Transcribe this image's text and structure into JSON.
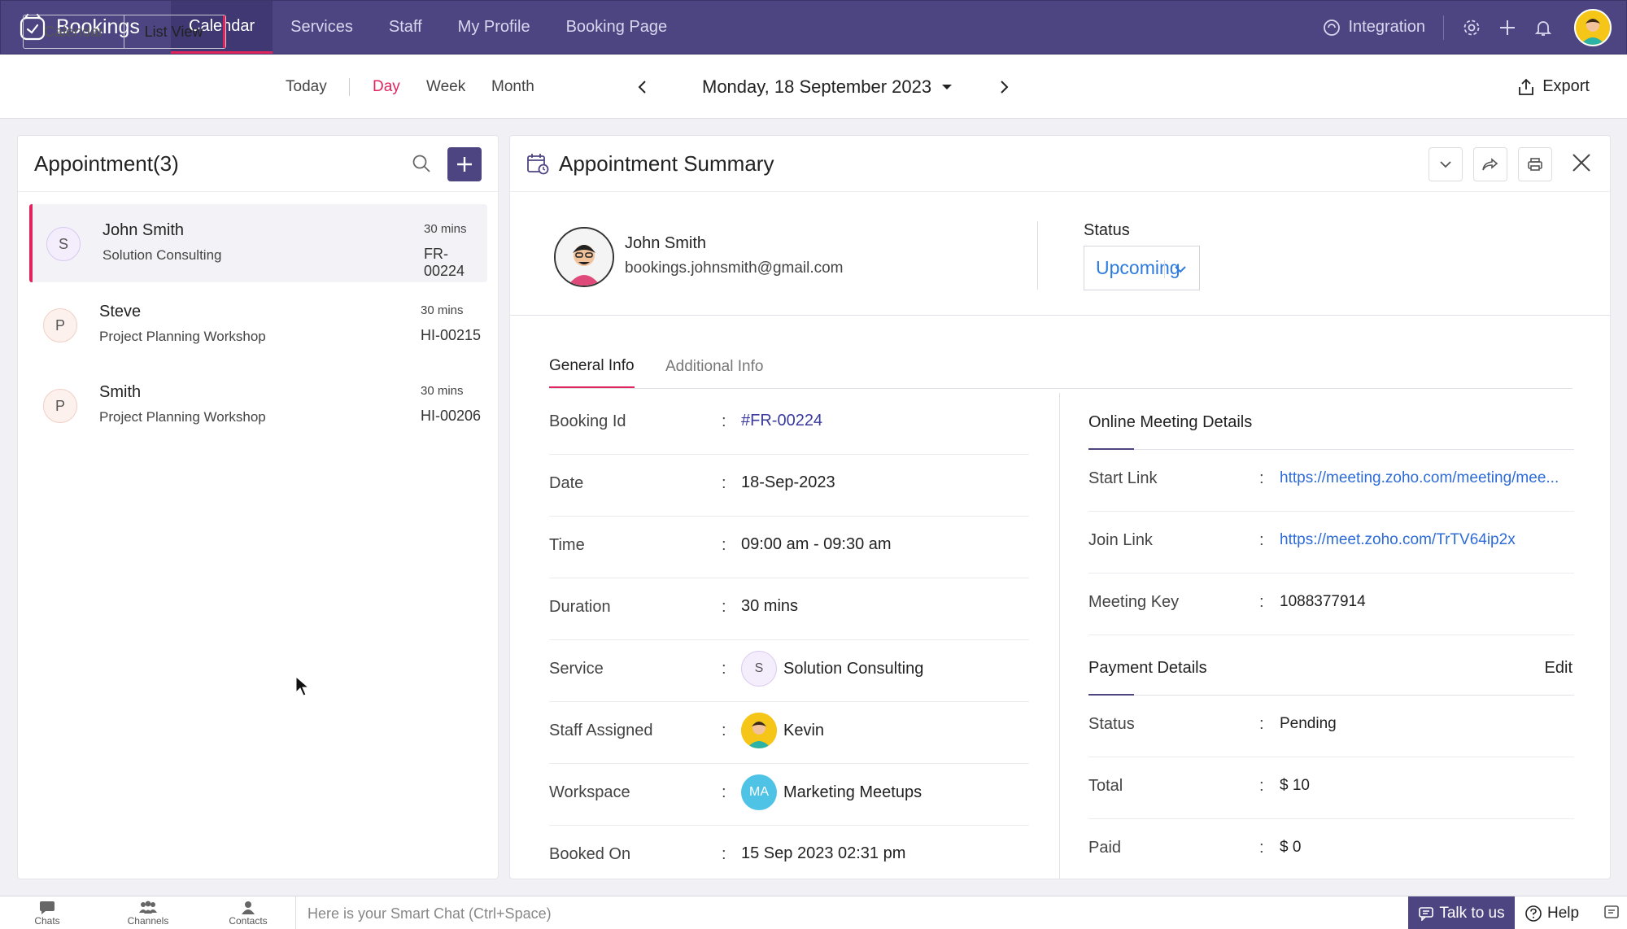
{
  "app": {
    "name": "Bookings",
    "nav": [
      "Calendar",
      "Services",
      "Staff",
      "My Profile",
      "Booking Page"
    ],
    "integration_label": "Integration"
  },
  "toolbar": {
    "view_toggle": [
      "Calendar",
      "List View"
    ],
    "today": "Today",
    "ranges": [
      "Day",
      "Week",
      "Month"
    ],
    "current_date": "Monday, 18 September 2023",
    "export": "Export"
  },
  "appointments": {
    "title": "Appointment(3)",
    "items": [
      {
        "initial": "S",
        "name": "John Smith",
        "service": "Solution Consulting",
        "duration": "30 mins",
        "id": "FR-00224"
      },
      {
        "initial": "P",
        "name": "Steve",
        "service": "Project Planning Workshop",
        "duration": "30 mins",
        "id": "HI-00215"
      },
      {
        "initial": "P",
        "name": "Smith",
        "service": "Project Planning Workshop",
        "duration": "30 mins",
        "id": "HI-00206"
      }
    ]
  },
  "summary": {
    "title": "Appointment Summary",
    "customer": {
      "name": "John Smith",
      "email": "bookings.johnsmith@gmail.com"
    },
    "status_label": "Status",
    "status_value": "Upcoming",
    "tabs": [
      "General Info",
      "Additional Info"
    ],
    "general": [
      {
        "label": "Booking Id",
        "value": "#FR-00224"
      },
      {
        "label": "Date",
        "value": "18-Sep-2023"
      },
      {
        "label": "Time",
        "value": "09:00 am - 09:30 am"
      },
      {
        "label": "Duration",
        "value": "30 mins"
      },
      {
        "label": "Service",
        "value": "Solution Consulting",
        "badge": "S"
      },
      {
        "label": "Staff Assigned",
        "value": "Kevin"
      },
      {
        "label": "Workspace",
        "value": "Marketing Meetups",
        "badge": "MA"
      },
      {
        "label": "Booked On",
        "value": "15 Sep 2023 02:31 pm"
      }
    ],
    "meeting": {
      "title": "Online Meeting Details",
      "rows": [
        {
          "label": "Start Link",
          "value": "https://meeting.zoho.com/meeting/mee..."
        },
        {
          "label": "Join Link",
          "value": "https://meet.zoho.com/TrTV64ip2x"
        },
        {
          "label": "Meeting Key",
          "value": "1088377914"
        }
      ]
    },
    "payment": {
      "title": "Payment Details",
      "edit": "Edit",
      "rows": [
        {
          "label": "Status",
          "value": "Pending"
        },
        {
          "label": "Total",
          "value": "$ 10"
        },
        {
          "label": "Paid",
          "value": "$ 0"
        }
      ]
    }
  },
  "bottombar": {
    "items": [
      "Chats",
      "Channels",
      "Contacts"
    ],
    "smart_chat_placeholder": "Here is your Smart Chat (Ctrl+Space)",
    "talk": "Talk to us",
    "help": "Help"
  },
  "colors": {
    "brand": "#4d4582",
    "accent": "#e0245e",
    "link": "#2d6bd6"
  }
}
